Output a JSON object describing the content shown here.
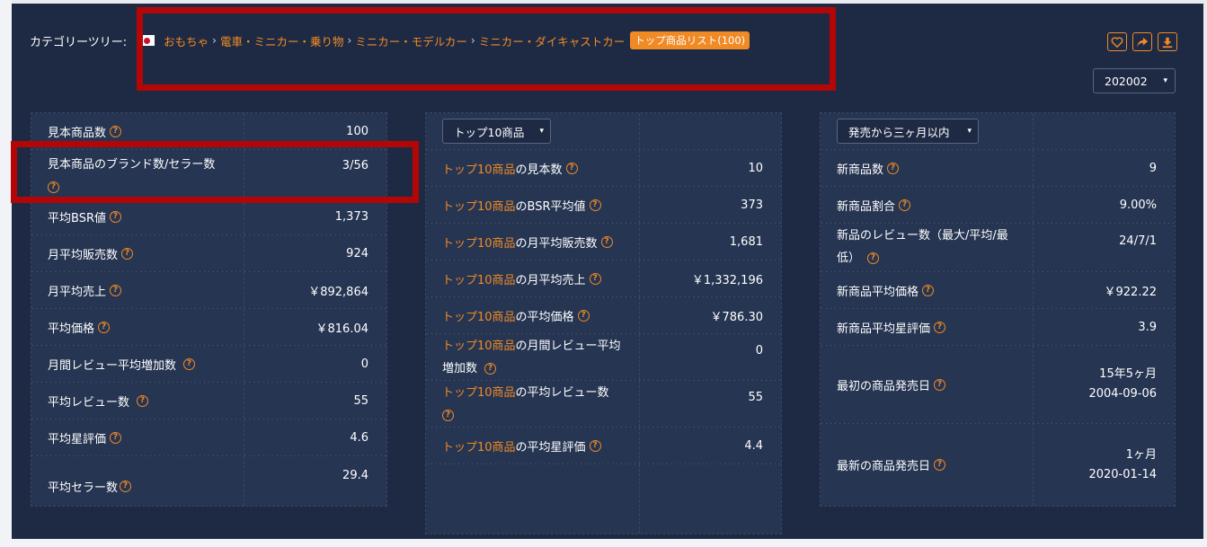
{
  "category": {
    "label": "カテゴリーツリー:",
    "crumbs": [
      "おもちゃ",
      "電車・ミニカー・乗り物",
      "ミニカー・モデルカー",
      "ミニカー・ダイキャストカー"
    ],
    "sep": "›",
    "badge": "トップ商品リスト(100)"
  },
  "month_select": "202002",
  "icons": [
    "heart-icon",
    "share-icon",
    "download-icon"
  ],
  "panel1": {
    "rows": [
      {
        "label": "見本商品数",
        "value": "100"
      },
      {
        "label": "見本商品のブランド数/セラー数",
        "value": "3/56"
      },
      {
        "label": "平均BSR値",
        "value": "1,373"
      },
      {
        "label": "月平均販売数",
        "value": "924"
      },
      {
        "label": "月平均売上",
        "value": "￥892,864"
      },
      {
        "label": "平均価格",
        "value": "￥816.04"
      },
      {
        "label": "月間レビュー平均増加数",
        "value": "0"
      },
      {
        "label": "平均レビュー数",
        "value": "55"
      },
      {
        "label": "平均星評価",
        "value": "4.6"
      },
      {
        "label": "平均セラー数",
        "value": "29.4"
      }
    ]
  },
  "panel2": {
    "select": "トップ10商品",
    "prefix": "トップ10商品",
    "rows": [
      {
        "suffix": "の見本数",
        "value": "10"
      },
      {
        "suffix": "のBSR平均値",
        "value": "373"
      },
      {
        "suffix": "の月平均販売数",
        "value": "1,681"
      },
      {
        "suffix": "の月平均売上",
        "value": "￥1,332,196"
      },
      {
        "suffix": "の平均価格",
        "value": "￥786.30"
      },
      {
        "suffix": "の月間レビュー平均増加数",
        "value": "0"
      },
      {
        "suffix": "の平均レビュー数",
        "value": "55"
      },
      {
        "suffix": "の平均星評価",
        "value": "4.4"
      }
    ]
  },
  "panel3": {
    "select": "発売から三ヶ月以内",
    "rows": [
      {
        "label": "新商品数",
        "value": "9"
      },
      {
        "label": "新商品割合",
        "value": "9.00%"
      },
      {
        "label": "新品のレビュー数（最大/平均/最低）",
        "value": "24/7/1"
      },
      {
        "label": "新商品平均価格",
        "value": "￥922.22"
      },
      {
        "label": "新商品平均星評価",
        "value": "3.9"
      },
      {
        "label": "最初の商品発売日",
        "value_line1": "15年5ヶ月",
        "value_line2": "2004-09-06"
      },
      {
        "label": "最新の商品発売日",
        "value_line1": "1ヶ月",
        "value_line2": "2020-01-14"
      }
    ]
  },
  "help_glyph": "?",
  "caret_glyph": "▾"
}
